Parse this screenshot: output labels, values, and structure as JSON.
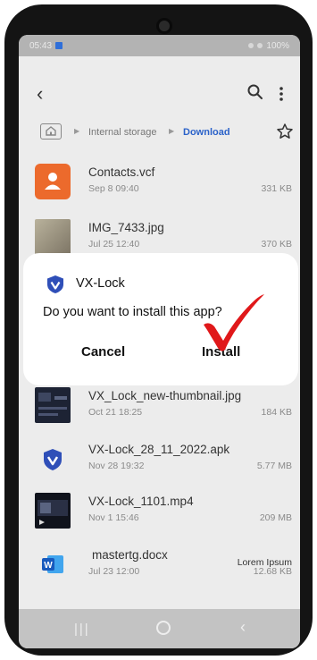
{
  "status_bar": {
    "time": "05:43",
    "right": "100%"
  },
  "breadcrumb": {
    "root": "Internal storage",
    "current": "Download"
  },
  "files": [
    {
      "name": "Contacts.vcf",
      "date": "Sep 8 09:40",
      "size": "331 KB",
      "icon": "contacts-icon"
    },
    {
      "name": "IMG_7433.jpg",
      "date": "Jul 25 12:40",
      "size": "370 KB",
      "icon": "image-thumbnail"
    },
    {
      "name": "VX_Lock_new-thumbnail.jpg",
      "date": "Oct 21 18:25",
      "size": "184 KB",
      "icon": "image-thumbnail"
    },
    {
      "name": "VX-Lock_28_11_2022.apk",
      "date": "Nov 28 19:32",
      "size": "5.77 MB",
      "icon": "vx-lock-shield-icon"
    },
    {
      "name": "VX-Lock_1101.mp4",
      "date": "Nov 1 15:46",
      "size": "209 MB",
      "icon": "video-thumbnail"
    },
    {
      "name": "mastertg.docx",
      "date": "Jul 23 12:00",
      "size": "12.68 KB",
      "extra": "Lorem Ipsum",
      "icon": "word-icon"
    }
  ],
  "dialog": {
    "app_name": "VX-Lock",
    "question": "Do you want to install this app?",
    "cancel_label": "Cancel",
    "install_label": "Install"
  },
  "colors": {
    "accent_blue": "#2b62c9",
    "contacts_orange": "#ec6a2c",
    "shield_blue": "#2f4fb8",
    "check_red": "#e0181a"
  }
}
